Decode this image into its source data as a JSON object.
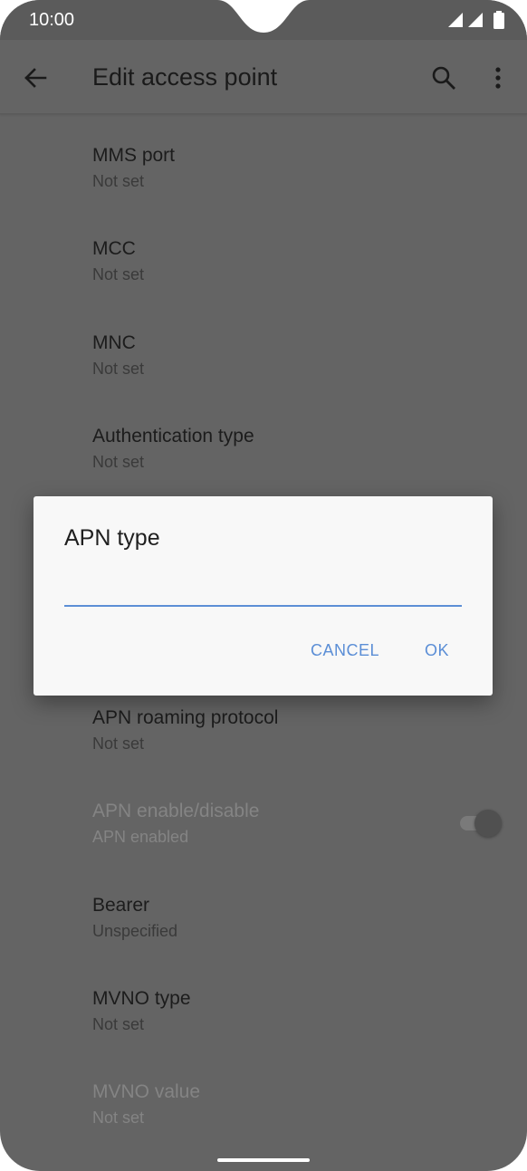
{
  "status_bar": {
    "time": "10:00"
  },
  "app_bar": {
    "title": "Edit access point"
  },
  "preferences": [
    {
      "title": "MMS port",
      "summary": "Not set",
      "disabled": false
    },
    {
      "title": "MCC",
      "summary": "Not set",
      "disabled": false
    },
    {
      "title": "MNC",
      "summary": "Not set",
      "disabled": false
    },
    {
      "title": "Authentication type",
      "summary": "Not set",
      "disabled": false
    },
    {
      "title": "APN roaming protocol",
      "summary": "Not set",
      "disabled": false
    },
    {
      "title": "APN enable/disable",
      "summary": "APN enabled",
      "disabled": true
    },
    {
      "title": "Bearer",
      "summary": "Unspecified",
      "disabled": false
    },
    {
      "title": "MVNO type",
      "summary": "Not set",
      "disabled": false
    },
    {
      "title": "MVNO value",
      "summary": "Not set",
      "disabled": true
    }
  ],
  "dialog": {
    "title": "APN type",
    "input_value": "",
    "cancel_label": "CANCEL",
    "ok_label": "OK"
  },
  "colors": {
    "accent": "#5b8ed6",
    "scrim_background": "#646464",
    "dialog_background": "#f8f8f8"
  },
  "icons": {
    "back": "arrow-left-icon",
    "search": "search-icon",
    "more": "more-vert-icon",
    "signal": "signal-icon",
    "battery": "battery-icon"
  }
}
